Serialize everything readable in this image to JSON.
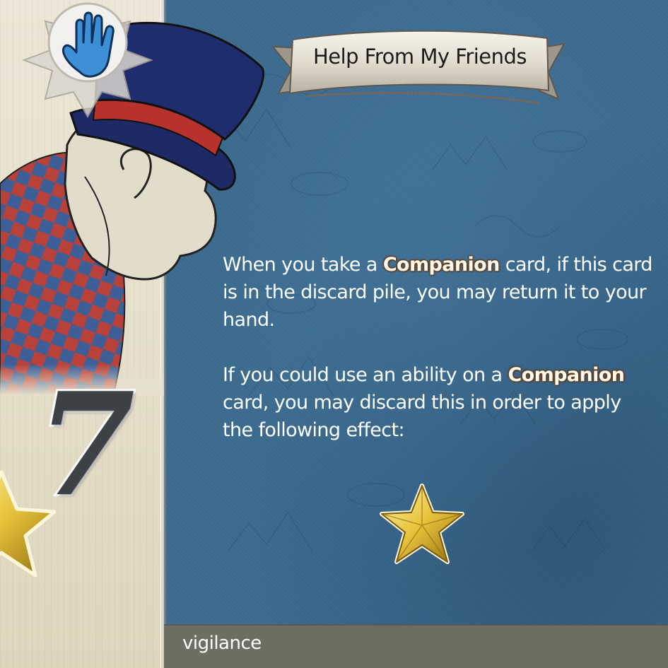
{
  "card": {
    "title": "Help From My Friends",
    "cost": "7",
    "ability_icon": "hand-icon",
    "effect_icon": "star-icon",
    "keyword": "vigilance",
    "rules": [
      {
        "before": "When you take a ",
        "keyword": "Companion",
        "after": " card, if this card is in the discard pile, you may return it to your hand."
      },
      {
        "before": "If you could use an ability on a ",
        "keyword": "Companion",
        "after": " card, you may discard this in order to apply the following effect:"
      }
    ]
  },
  "colors": {
    "panel_blue": "#3b6b8f",
    "parchment": "#e6dfcb",
    "footer": "#6f6e63",
    "star_gold": "#e6c23a",
    "hand_blue": "#3d8fd6"
  }
}
